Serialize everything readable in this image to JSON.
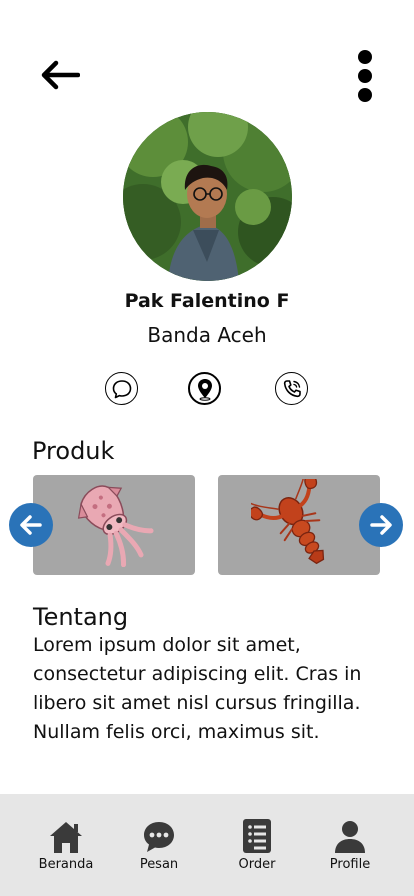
{
  "header": {
    "back_icon": "arrow-left-icon",
    "menu_icon": "more-vertical-icon"
  },
  "profile": {
    "name": "Pak Falentino F",
    "city": "Banda Aceh"
  },
  "actions": [
    {
      "icon": "chat-icon"
    },
    {
      "icon": "location-pin-icon"
    },
    {
      "icon": "phone-icon"
    }
  ],
  "produk": {
    "title": "Produk",
    "items": [
      {
        "icon": "squid-icon"
      },
      {
        "icon": "lobster-icon"
      }
    ]
  },
  "tentang": {
    "title": "Tentang",
    "text": "Lorem ipsum dolor sit amet, consectetur adipiscing elit. Cras in libero sit amet nisl cursus fringilla. Nullam felis orci, maximus sit."
  },
  "bottom_nav": {
    "items": [
      {
        "label": "Beranda",
        "icon": "home-icon"
      },
      {
        "label": "Pesan",
        "icon": "message-icon"
      },
      {
        "label": "Order",
        "icon": "order-list-icon"
      },
      {
        "label": "Profile",
        "icon": "user-icon"
      }
    ]
  },
  "colors": {
    "arrow_button": "#2a73b8",
    "product_card": "#a6a6a6",
    "bottom_nav_bg": "#e6e6e6"
  }
}
